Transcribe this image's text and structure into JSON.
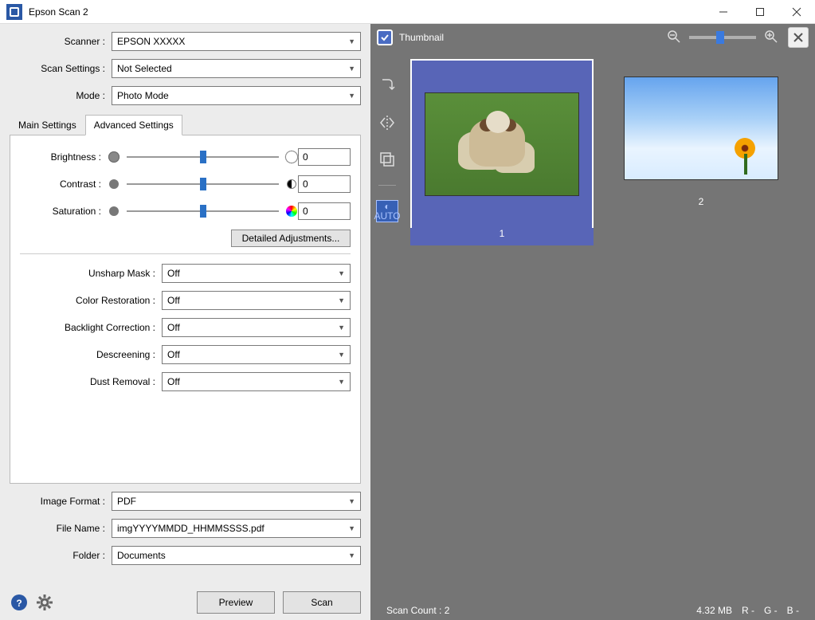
{
  "window": {
    "title": "Epson Scan 2"
  },
  "labels": {
    "scanner": "Scanner :",
    "scanSettings": "Scan Settings :",
    "mode": "Mode :",
    "brightness": "Brightness :",
    "contrast": "Contrast :",
    "saturation": "Saturation :",
    "unsharp": "Unsharp Mask :",
    "colorRestore": "Color Restoration :",
    "backlight": "Backlight Correction :",
    "descreening": "Descreening :",
    "dust": "Dust Removal :",
    "imageFormat": "Image Format :",
    "fileName": "File Name :",
    "folder": "Folder :"
  },
  "values": {
    "scanner": "EPSON XXXXX",
    "scanSettings": "Not Selected",
    "mode": "Photo Mode",
    "brightness": "0",
    "contrast": "0",
    "saturation": "0",
    "unsharp": "Off",
    "colorRestore": "Off",
    "backlight": "Off",
    "descreening": "Off",
    "dust": "Off",
    "imageFormat": "PDF",
    "fileName": "imgYYYYMMDD_HHMMSSSS.pdf",
    "folder": "Documents"
  },
  "tabs": {
    "main": "Main Settings",
    "advanced": "Advanced Settings"
  },
  "buttons": {
    "detailed": "Detailed Adjustments...",
    "preview": "Preview",
    "scan": "Scan"
  },
  "previewPane": {
    "thumbnailLabel": "Thumbnail",
    "thumbs": [
      {
        "id": "1"
      },
      {
        "id": "2"
      }
    ]
  },
  "status": {
    "scanCount": "Scan Count : 2",
    "size": "4.32 MB",
    "r": "R   -",
    "g": "G   -",
    "b": "B   -"
  }
}
